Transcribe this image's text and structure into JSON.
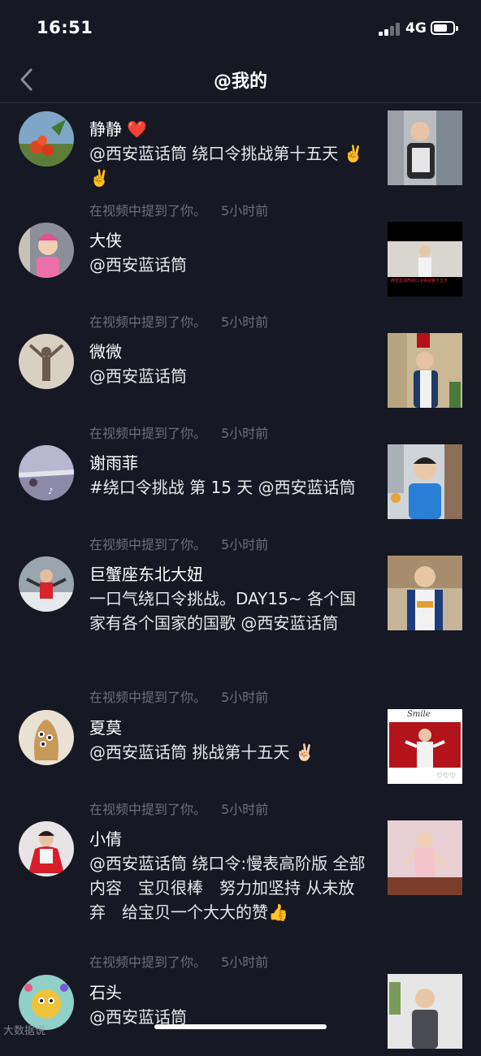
{
  "status_bar": {
    "time": "16:51",
    "network": "4G",
    "battery_level": 0.72
  },
  "header": {
    "title": "@我的"
  },
  "notifications": [
    {
      "user": "静静 ❤️",
      "text": "@西安蓝话筒 绕口令挑战第十五天 ✌️✌️",
      "action": "在视频中提到了你。",
      "time": "5小时前"
    },
    {
      "user": "大侠",
      "text": "@西安蓝话筒",
      "action": "在视频中提到了你。",
      "time": "5小时前",
      "thumb_caption": "西安蓝话筒绕口令挑战第十五天"
    },
    {
      "user": "微微",
      "text": "@西安蓝话筒",
      "action": "在视频中提到了你。",
      "time": "5小时前"
    },
    {
      "user": "谢雨菲",
      "text": "#绕口令挑战 第 15 天 @西安蓝话筒",
      "action": "在视频中提到了你。",
      "time": "5小时前"
    },
    {
      "user": "巨蟹座东北大妞",
      "text": "一口气绕口令挑战。DAY15~ 各个国家有各个国家的国歌 @西安蓝话筒",
      "action": "在视频中提到了你。",
      "time": "5小时前"
    },
    {
      "user": "夏莫",
      "text": "@西安蓝话筒 挑战第十五天 ✌🏻",
      "action": "在视频中提到了你。",
      "time": "5小时前",
      "thumb_caption": "Smile"
    },
    {
      "user": "小倩",
      "text": "@西安蓝话筒 绕口令:慢表高阶版 全部内容　宝贝很棒　努力加坚持 从未放弃　给宝贝一个大大的赞👍",
      "action": "在视频中提到了你。",
      "time": "5小时前"
    },
    {
      "user": "石头",
      "text": "@西安蓝话筒",
      "action": "",
      "time": ""
    }
  ],
  "watermark": "大数据说",
  "colors": {
    "background": "#161823",
    "secondary_text": "#6c6e78",
    "divider": "#2a2c37"
  }
}
